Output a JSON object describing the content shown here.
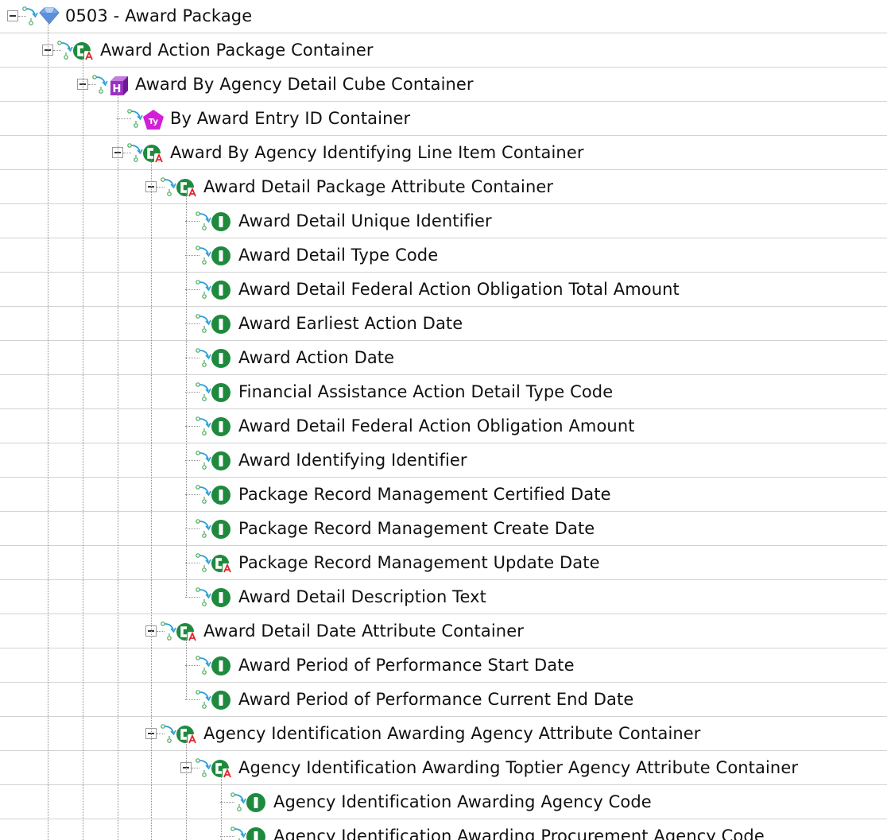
{
  "tree": {
    "nodes": [
      {
        "label": "0503 - Award Package",
        "icon": "diamond-icon",
        "depth": 0,
        "expander": true
      },
      {
        "label": "Award Action Package Container",
        "icon": "abstract-class-icon",
        "depth": 1,
        "expander": true
      },
      {
        "label": "Award By Agency Detail Cube Container",
        "icon": "cube-h-icon",
        "depth": 2,
        "expander": true
      },
      {
        "label": "By Award Entry ID Container",
        "icon": "type-pentagon-icon",
        "depth": 3,
        "expander": false
      },
      {
        "label": "Award By Agency Identifying Line Item Container",
        "icon": "abstract-class-icon",
        "depth": 3,
        "expander": true
      },
      {
        "label": "Award Detail Package Attribute Container",
        "icon": "abstract-class-icon",
        "depth": 4,
        "expander": true
      },
      {
        "label": "Award Detail Unique Identifier",
        "icon": "info-element-icon",
        "depth": 5,
        "expander": false
      },
      {
        "label": "Award Detail Type Code",
        "icon": "info-element-icon",
        "depth": 5,
        "expander": false
      },
      {
        "label": "Award Detail Federal Action Obligation Total Amount",
        "icon": "info-element-icon",
        "depth": 5,
        "expander": false
      },
      {
        "label": "Award Earliest Action Date",
        "icon": "info-element-icon",
        "depth": 5,
        "expander": false
      },
      {
        "label": "Award Action Date",
        "icon": "info-element-icon",
        "depth": 5,
        "expander": false
      },
      {
        "label": "Financial Assistance Action Detail Type Code",
        "icon": "info-element-icon",
        "depth": 5,
        "expander": false
      },
      {
        "label": "Award Detail Federal Action Obligation Amount",
        "icon": "info-element-icon",
        "depth": 5,
        "expander": false
      },
      {
        "label": "Award Identifying Identifier",
        "icon": "info-element-icon",
        "depth": 5,
        "expander": false
      },
      {
        "label": "Package Record Management Certified Date",
        "icon": "info-element-icon",
        "depth": 5,
        "expander": false
      },
      {
        "label": "Package Record Management Create Date",
        "icon": "info-element-icon",
        "depth": 5,
        "expander": false
      },
      {
        "label": "Package Record Management Update Date",
        "icon": "abstract-class-icon",
        "depth": 5,
        "expander": false
      },
      {
        "label": "Award Detail Description Text",
        "icon": "info-element-icon",
        "depth": 5,
        "expander": false
      },
      {
        "label": "Award Detail Date Attribute Container",
        "icon": "abstract-class-icon",
        "depth": 4,
        "expander": true
      },
      {
        "label": "Award Period of Performance Start Date",
        "icon": "info-element-icon",
        "depth": 5,
        "expander": false
      },
      {
        "label": "Award Period of Performance Current End Date",
        "icon": "info-element-icon",
        "depth": 5,
        "expander": false
      },
      {
        "label": "Agency Identification Awarding Agency Attribute Container",
        "icon": "abstract-class-icon",
        "depth": 4,
        "expander": true
      },
      {
        "label": "Agency Identification Awarding Toptier Agency Attribute Container",
        "icon": "abstract-class-icon",
        "depth": 5,
        "expander": true
      },
      {
        "label": "Agency Identification Awarding Agency Code",
        "icon": "info-element-icon",
        "depth": 6,
        "expander": false
      },
      {
        "label": "Agency Identification Awarding Procurement Agency Code",
        "icon": "info-element-icon",
        "depth": 6,
        "expander": false
      }
    ]
  },
  "colors": {
    "element_green": "#1f8a3e",
    "abstract_red": "#e0262b",
    "cube_purple": "#9b2fc4",
    "type_magenta": "#d21fd6",
    "diamond_blue": "#7aa8e6",
    "link_cyan": "#2aa0d8",
    "link_green": "#49a85a",
    "grid_line": "#d2d2d2",
    "connector": "#8c8c8c"
  }
}
